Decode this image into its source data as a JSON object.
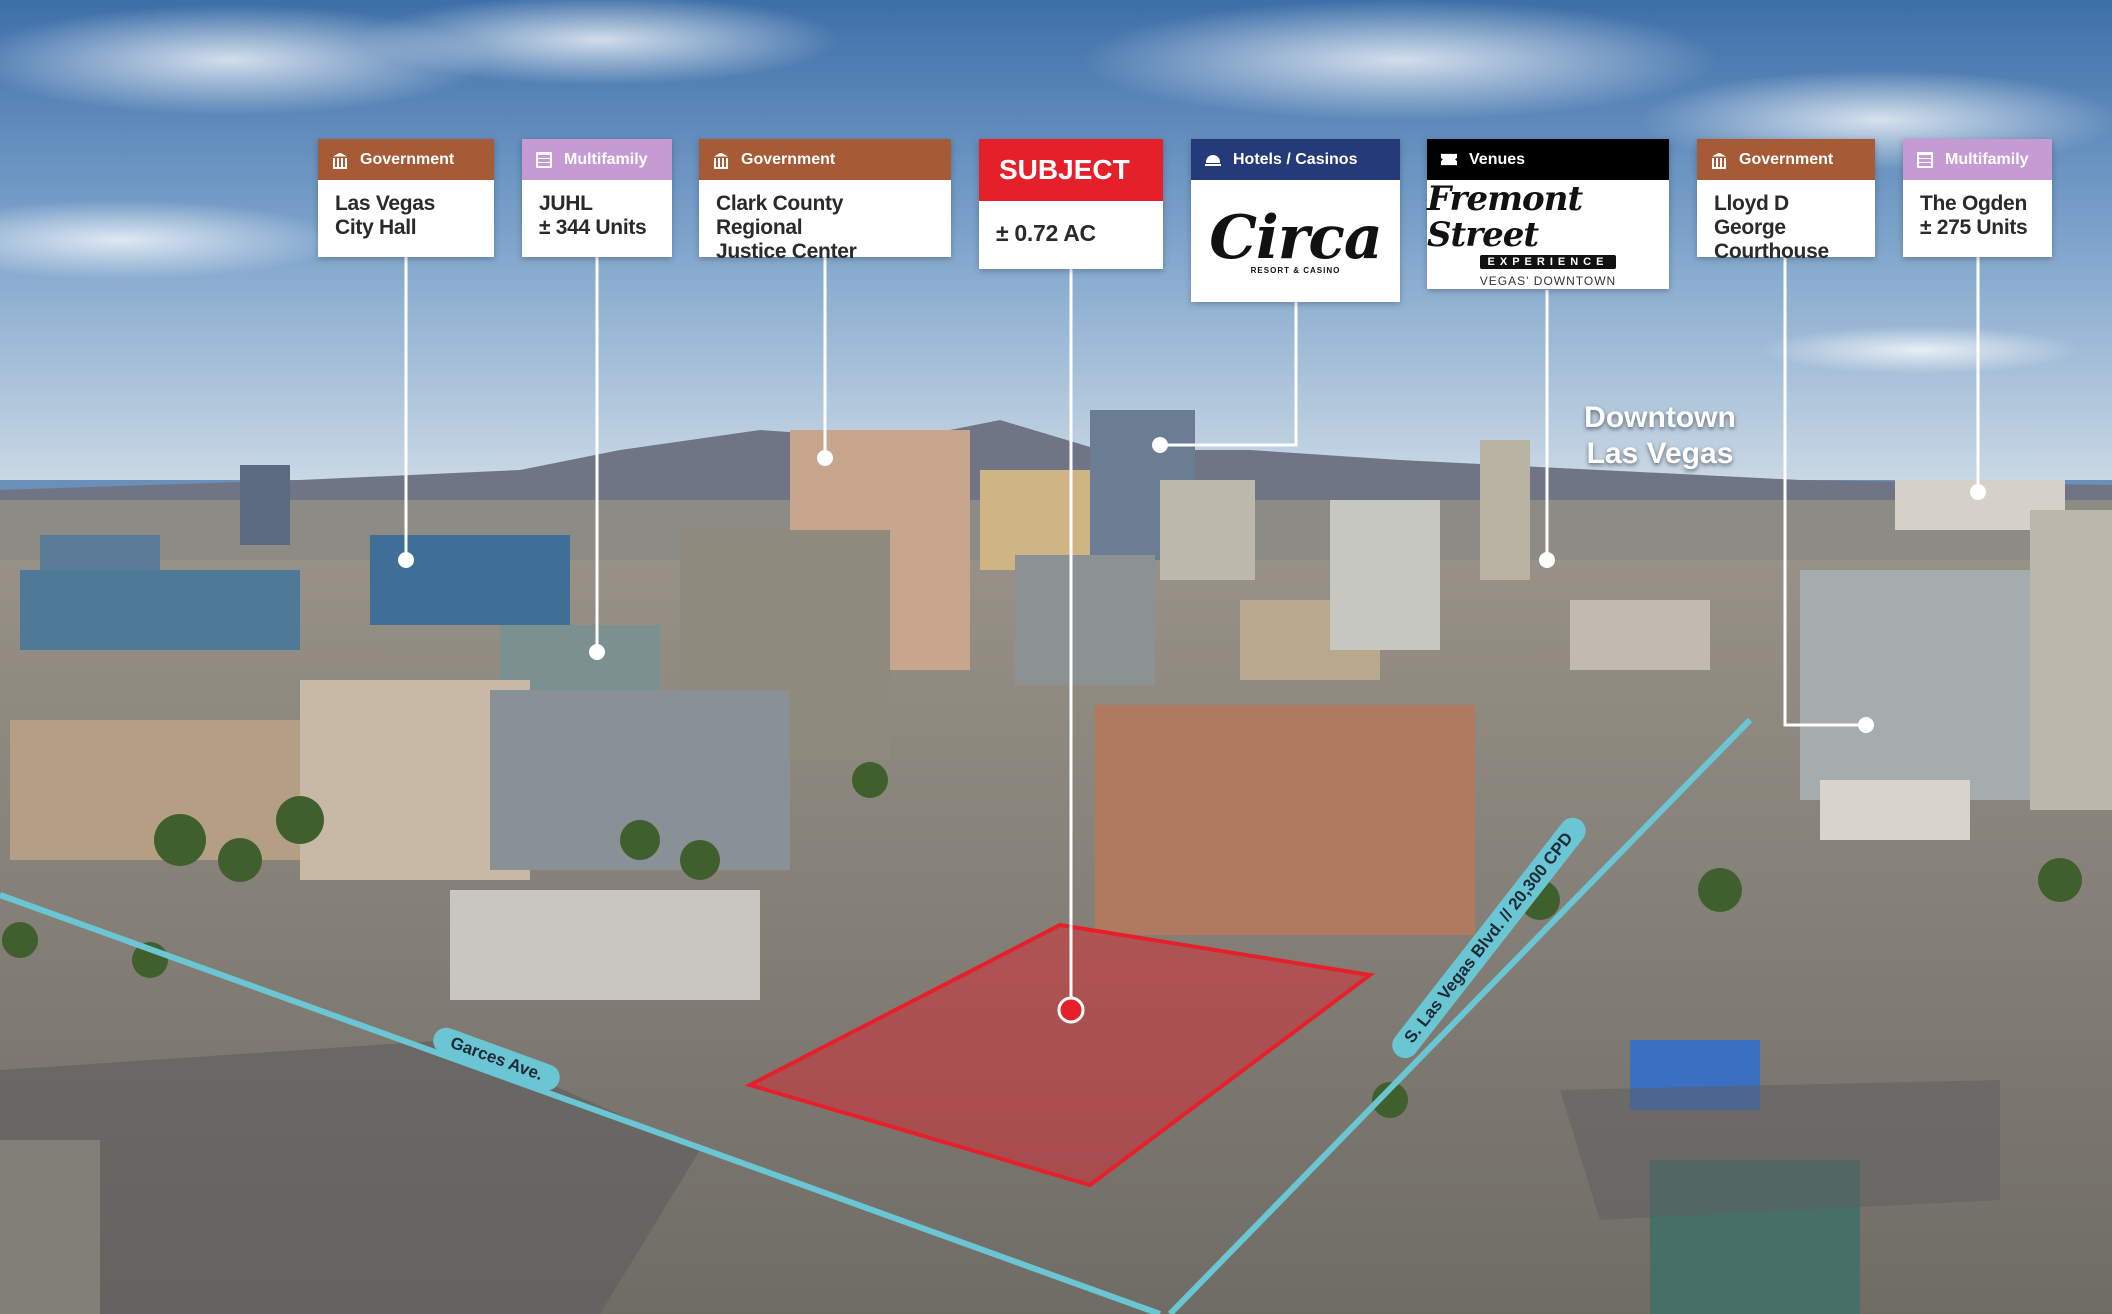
{
  "colors": {
    "government": "#a65a36",
    "multifamily": "#c69bd3",
    "hotels": "#253a78",
    "venues": "#000000",
    "subject": "#e5202a",
    "street_line": "#6bc6d3"
  },
  "callouts": [
    {
      "category": "Government",
      "icon": "government-building-icon",
      "name": "Las Vegas\nCity Hall"
    },
    {
      "category": "Multifamily",
      "icon": "apartment-building-icon",
      "name": "JUHL\n± 344 Units"
    },
    {
      "category": "Government",
      "icon": "government-building-icon",
      "name": "Clark County Regional\nJustice Center"
    },
    {
      "category": "SUBJECT",
      "name": "± 0.72 AC"
    },
    {
      "category": "Hotels / Casinos",
      "icon": "hotel-bell-icon",
      "logo": {
        "word": "Circa",
        "sub": "RESORT & CASINO"
      }
    },
    {
      "category": "Venues",
      "icon": "ticket-icon",
      "logo": {
        "word": "Fremont Street",
        "band": "EXPERIENCE",
        "sub": "VEGAS' DOWNTOWN"
      }
    },
    {
      "category": "Government",
      "icon": "government-building-icon",
      "name": "Lloyd D George\nCourthouse"
    },
    {
      "category": "Multifamily",
      "icon": "apartment-building-icon",
      "name": "The Ogden\n± 275 Units"
    }
  ],
  "area_label": "Downtown\nLas Vegas",
  "streets": {
    "garces": "Garces Ave.",
    "las_vegas_blvd": "S. Las Vegas Blvd. // 20,300 CPD"
  }
}
